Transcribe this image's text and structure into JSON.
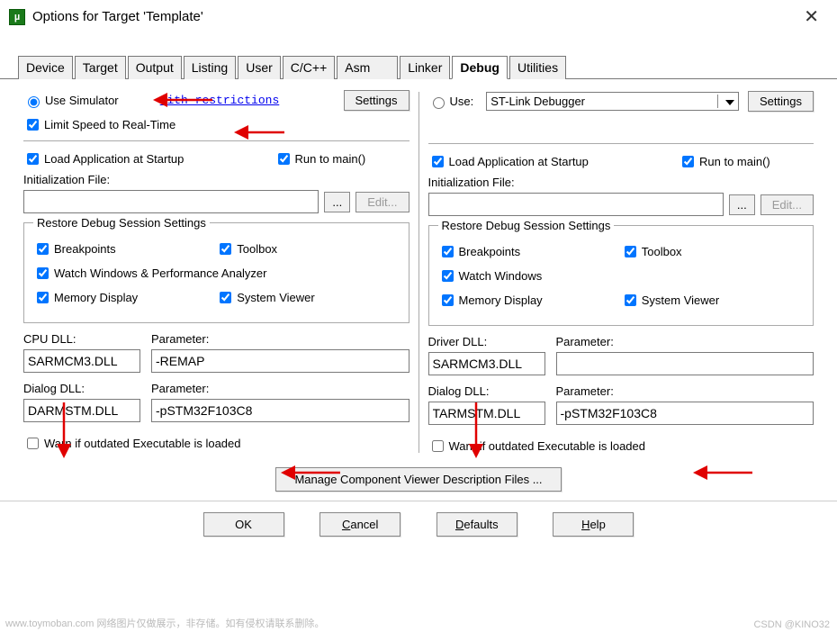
{
  "title": "Options for Target 'Template'",
  "tabs": [
    "Device",
    "Target",
    "Output",
    "Listing",
    "User",
    "C/C++",
    "Asm",
    "Linker",
    "Debug",
    "Utilities"
  ],
  "active_tab": "Debug",
  "left": {
    "use_sim_label": "Use Simulator",
    "restrictions": "with restrictions",
    "settings_btn": "Settings",
    "limit_label": "Limit Speed to Real-Time",
    "load_app": "Load Application at Startup",
    "run_main": "Run to main()",
    "init_file": "Initialization File:",
    "browse": "...",
    "edit": "Edit...",
    "restore_legend": "Restore Debug Session Settings",
    "breakpoints": "Breakpoints",
    "toolbox": "Toolbox",
    "watch": "Watch Windows & Performance Analyzer",
    "memdisp": "Memory Display",
    "sysview": "System Viewer",
    "cpu_dll_label": "CPU DLL:",
    "param_label": "Parameter:",
    "cpu_dll": "SARMCM3.DLL",
    "cpu_param": "-REMAP",
    "dialog_dll_label": "Dialog DLL:",
    "dialog_dll": "DARMSTM.DLL",
    "dialog_param": "-pSTM32F103C8",
    "warn": "Warn if outdated Executable is loaded"
  },
  "right": {
    "use_label": "Use:",
    "debugger": "ST-Link Debugger",
    "settings_btn": "Settings",
    "load_app": "Load Application at Startup",
    "run_main": "Run to main()",
    "init_file": "Initialization File:",
    "browse": "...",
    "edit": "Edit...",
    "restore_legend": "Restore Debug Session Settings",
    "breakpoints": "Breakpoints",
    "toolbox": "Toolbox",
    "watch": "Watch Windows",
    "memdisp": "Memory Display",
    "sysview": "System Viewer",
    "driver_dll_label": "Driver DLL:",
    "param_label": "Parameter:",
    "driver_dll": "SARMCM3.DLL",
    "driver_param": "",
    "dialog_dll_label": "Dialog DLL:",
    "dialog_dll": "TARMSTM.DLL",
    "dialog_param": "-pSTM32F103C8",
    "warn": "Warn if outdated Executable is loaded"
  },
  "manage_btn": "Manage Component Viewer Description Files ...",
  "buttons": {
    "ok": "OK",
    "cancel": "Cancel",
    "defaults": "Defaults",
    "help": "Help"
  },
  "watermark_l": "www.toymoban.com 网络图片仅做展示，非存储。如有侵权请联系删除。",
  "watermark_r": "CSDN @KINO32"
}
